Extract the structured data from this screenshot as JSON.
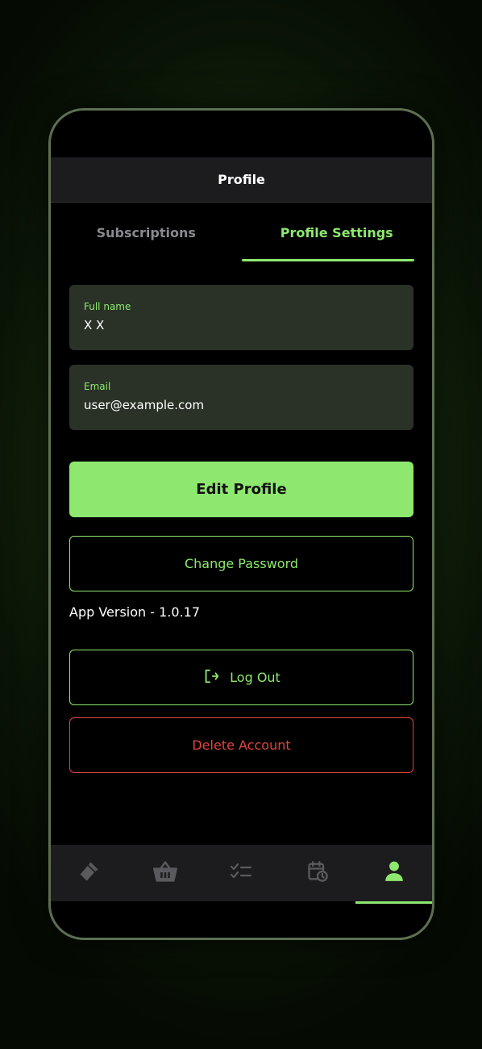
{
  "header": {
    "title": "Profile"
  },
  "tabs": [
    {
      "label": "Subscriptions",
      "active": false
    },
    {
      "label": "Profile Settings",
      "active": true
    }
  ],
  "form": {
    "full_name": {
      "label": "Full name",
      "value": "X X"
    },
    "email": {
      "label": "Email",
      "value": "user@example.com"
    }
  },
  "buttons": {
    "edit_profile": "Edit Profile",
    "change_password": "Change Password",
    "log_out": "Log Out",
    "delete_account": "Delete Account"
  },
  "app_version": "App Version - 1.0.17",
  "bottom_nav": [
    {
      "icon": "flashlight-icon",
      "active": false
    },
    {
      "icon": "basket-icon",
      "active": false
    },
    {
      "icon": "checklist-icon",
      "active": false
    },
    {
      "icon": "calendar-clock-icon",
      "active": false
    },
    {
      "icon": "profile-icon",
      "active": true
    }
  ],
  "colors": {
    "accent": "#8ee86f",
    "danger": "#e0453d",
    "field_bg": "#2a3227",
    "nav_inactive": "#5a5a5e"
  }
}
